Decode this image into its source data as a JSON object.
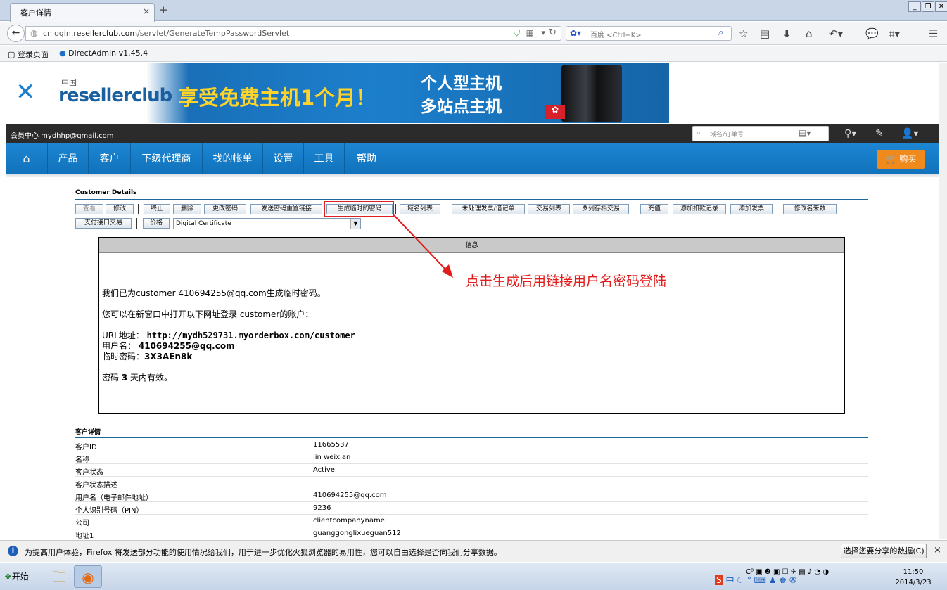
{
  "browser": {
    "tab_title": "客户详情",
    "tab_close": "×",
    "new_tab": "+",
    "url_prefix": "cnlogin.",
    "url_domain": "resellerclub.com",
    "url_path": "/servlet/GenerateTempPasswordServlet",
    "search_placeholder": "百度 <Ctrl+K>",
    "bookmarks": [
      "登录页面",
      "DirectAdmin v1.45.4"
    ]
  },
  "header": {
    "logo_cn": "中国",
    "logo_text": "resellerclub",
    "promo_main": "享受免费主机1个月！",
    "promo_line1": "个人型主机",
    "promo_line2": "多站点主机",
    "user_label": "会员中心 mydhhp@gmail.com",
    "search_placeholder": "域名/订单号"
  },
  "nav": {
    "home_icon": "home-icon",
    "items": [
      "产品",
      "客户",
      "下级代理商",
      "找的帐单",
      "设置",
      "工具",
      "帮助"
    ],
    "buy_label": "购买"
  },
  "customer_section": {
    "title": "Customer Details",
    "buttons_row1": [
      "查看",
      "修改",
      "终止",
      "删除",
      "更改密码",
      "发送密码重置链接",
      "生成临时的密码",
      "域名列表",
      "未处理发票/借记单",
      "交易列表",
      "罗列存档交易",
      "充值",
      "添加扣款记录",
      "添加发票",
      "修改名来数"
    ],
    "buttons_row2": [
      "支付接口交易",
      "价格"
    ],
    "select_value": "Digital Certificate"
  },
  "info_box": {
    "header": "信息",
    "line1": "我们已为customer 410694255@qq.com生成临时密码。",
    "line2": "您可以在新窗口中打开以下网址登录 customer的账户：",
    "url_label": "URL地址：",
    "url_value": "http://mydh529731.myorderbox.com/customer",
    "user_label": "用户名：",
    "user_value": "410694255@qq.com",
    "pwd_label": "临时密码：",
    "pwd_value": "3X3AEn8k",
    "validity_prefix": "密码 ",
    "validity_days": "3",
    "validity_suffix": " 天内有效。"
  },
  "annotation": "点击生成后用链接用户名密码登陆",
  "details": {
    "title": "客户详情",
    "rows": [
      {
        "k": "客户ID",
        "v": "11665537"
      },
      {
        "k": "名称",
        "v": "lin weixian"
      },
      {
        "k": "客户状态",
        "v": "Active"
      },
      {
        "k": "客户状态描述",
        "v": ""
      },
      {
        "k": "用户名（电子邮件地址）",
        "v": "410694255@qq.com"
      },
      {
        "k": "个人识别号码（PIN）",
        "v": "9236"
      },
      {
        "k": "公司",
        "v": "clientcompanyname"
      },
      {
        "k": "地址1",
        "v": "guanggonglixueguan512"
      }
    ]
  },
  "notification": {
    "text": "为提高用户体验，Firefox 将发送部分功能的使用情况给我们，用于进一步优化火狐浏览器的易用性，您可以自由选择是否向我们分享数据。",
    "button": "选择您要分享的数据(C)",
    "close": "×"
  },
  "taskbar": {
    "start": "开始",
    "time": "11:50",
    "date": "2014/3/23",
    "ime": "中"
  }
}
